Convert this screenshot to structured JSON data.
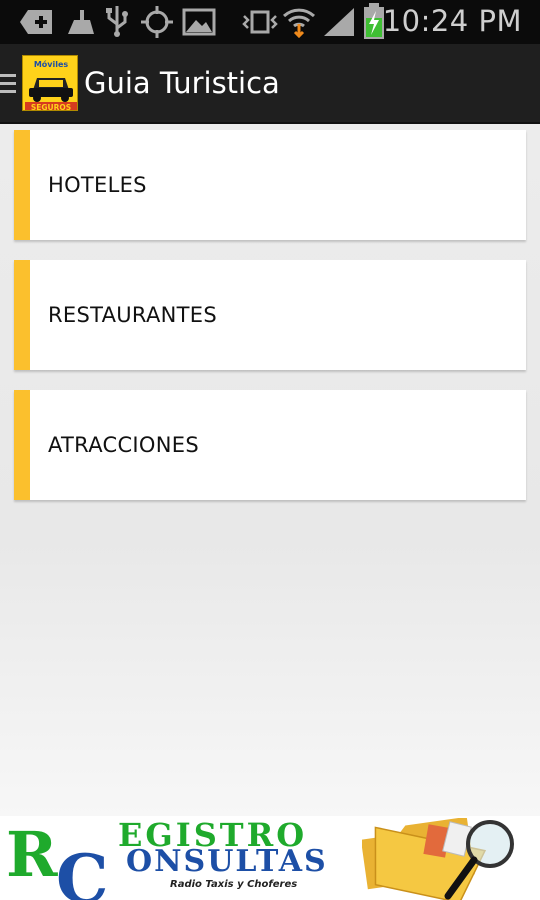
{
  "status_bar": {
    "time": "10:24 PM",
    "icons": [
      "add-notification-icon",
      "cleaner-icon",
      "usb-icon",
      "gps-icon",
      "image-icon",
      "vibrate-icon",
      "wifi-icon",
      "signal-icon",
      "battery-charging-icon"
    ]
  },
  "action_bar": {
    "title": "Guia Turistica",
    "logo_text_top": "Móviles",
    "logo_text_bottom": "SEGUROS",
    "icons": [
      "drawer-menu-icon",
      "taxi-logo-icon"
    ]
  },
  "menu": {
    "items": [
      {
        "label": "HOTELES"
      },
      {
        "label": "RESTAURANTES"
      },
      {
        "label": "ATRACCIONES"
      }
    ],
    "accent_color": "#fbc02d"
  },
  "banner": {
    "brand_line1": "EGISTRO",
    "brand_line2": "ONSULTAS",
    "brand_initial1": "R",
    "brand_initial2": "C",
    "tagline": "Radio Taxis y Choferes",
    "icons": [
      "folder-magnifier-icon"
    ],
    "colors": {
      "green": "#1faa2c",
      "blue": "#1d4fa6"
    }
  }
}
